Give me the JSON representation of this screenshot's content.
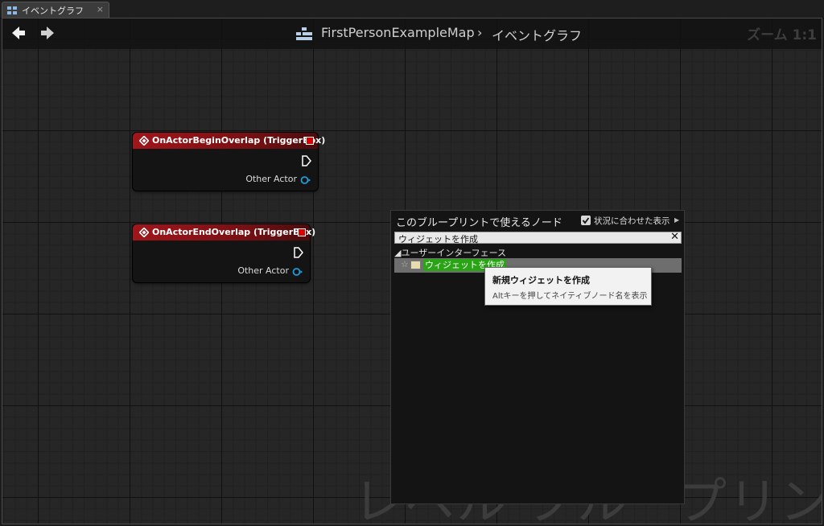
{
  "tab": {
    "label": "イベントグラフ",
    "close": "×"
  },
  "header": {
    "breadcrumb_map": "FirstPersonExampleMap",
    "breadcrumb_sep": "›",
    "breadcrumb_graph": "イベントグラフ",
    "zoom": "ズーム 1:1"
  },
  "watermark": "レベル ブループリント",
  "nodes": [
    {
      "title": "OnActorBeginOverlap (TriggerBox)",
      "pin_label": "Other Actor"
    },
    {
      "title": "OnActorEndOverlap (TriggerBox)",
      "pin_label": "Other Actor"
    }
  ],
  "palette": {
    "title": "このブループリントで使えるノード",
    "context_label": "状況に合わせた表示",
    "context_checked": true,
    "search_value": "ウィジェットを作成",
    "category": "◢ユーザーインターフェース",
    "result_label": "ウィジェットを作成",
    "star": "☆"
  },
  "tooltip": {
    "title": "新規ウィジェットを作成",
    "hint": "Altキーを押してネイティブノード名を表示"
  },
  "colors": {
    "node_header": "#a0161b",
    "highlight": "#28a414",
    "pin": "#1d9bd8"
  }
}
